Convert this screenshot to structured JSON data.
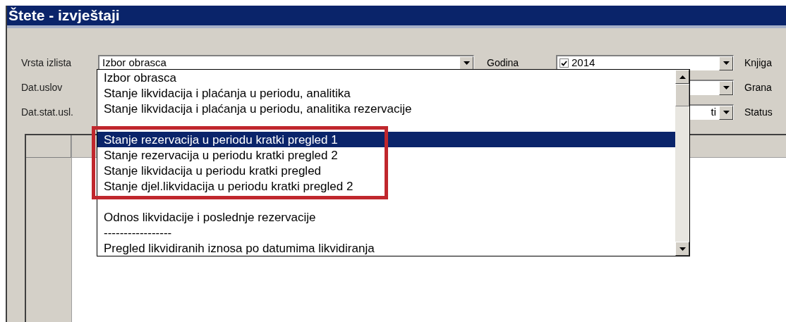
{
  "window": {
    "title": "Štete - izvještaji"
  },
  "form": {
    "rows": [
      {
        "label": "Vrsta izlista",
        "main_combo": {
          "value": "Izbor obrasca"
        },
        "side_label": "Godina",
        "side_combo": {
          "value": "2014",
          "checked": true
        },
        "right_label": "Knjiga"
      },
      {
        "label": "Dat.uslov",
        "right_label": "Grana"
      },
      {
        "label": "Dat.stat.usl.",
        "side_combo": {
          "value": "ti"
        },
        "right_label": "Status"
      }
    ]
  },
  "dropdown": {
    "groups": [
      {
        "highlighted": false,
        "items": [
          {
            "label": "Izbor obrasca",
            "selected": false
          },
          {
            "label": "Stanje likvidacija i plaćanja u periodu, analitika",
            "selected": false
          },
          {
            "label": "Stanje likvidacija i plaćanja u periodu, analitika rezervacije",
            "selected": false
          }
        ]
      },
      {
        "highlighted": true,
        "items": [
          {
            "label": "Stanje rezervacija u periodu kratki pregled 1",
            "selected": true
          },
          {
            "label": "Stanje rezervacija u periodu kratki pregled 2",
            "selected": false
          },
          {
            "label": "Stanje likvidacija  u periodu kratki pregled",
            "selected": false
          },
          {
            "label": "Stanje djel.likvidacija u periodu kratki pregled 2",
            "selected": false
          }
        ]
      },
      {
        "highlighted": false,
        "items": [
          {
            "label": "Odnos likvidacije i poslednje rezervacije",
            "selected": false
          },
          {
            "label": "-----------------",
            "selected": false
          },
          {
            "label": "Pregled likvidiranih iznosa po datumima likvidiranja",
            "selected": false
          }
        ]
      }
    ]
  }
}
